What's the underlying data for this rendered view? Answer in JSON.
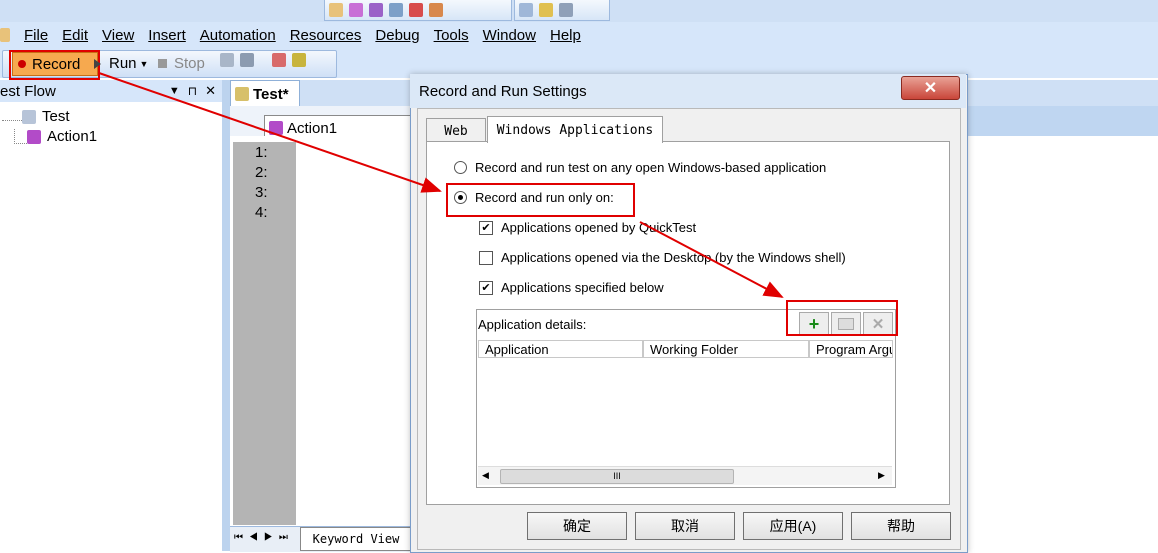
{
  "menu": [
    "File",
    "Edit",
    "View",
    "Insert",
    "Automation",
    "Resources",
    "Debug",
    "Tools",
    "Window",
    "Help"
  ],
  "toolbar": {
    "record_label": "Record",
    "run_label": "Run",
    "stop_label": "Stop"
  },
  "left_panel": {
    "title": "est Flow",
    "tree_root": "Test",
    "tree_child": "Action1"
  },
  "editor": {
    "tab_title": "Test*",
    "action_name": "Action1",
    "line_numbers": [
      "1:",
      "2:",
      "3:",
      "4:"
    ],
    "bottom_tab": "Keyword View"
  },
  "dialog": {
    "title": "Record and Run Settings",
    "close": "✕",
    "tabs": [
      "Web",
      "Windows Applications"
    ],
    "radio_any": "Record and run test on any open Windows-based application",
    "radio_only": "Record and run only on:",
    "check_quicktest": "Applications opened by QuickTest",
    "check_desktop": "Applications opened via the Desktop (by the Windows shell)",
    "check_specified": "Applications specified below",
    "app_details_label": "Application details:",
    "columns": [
      "Application",
      "Working Folder",
      "Program Argu"
    ],
    "scroll_grip": "III",
    "buttons": [
      "确定",
      "取消",
      "应用(A)",
      "帮助"
    ]
  },
  "colors": {
    "highlight": "#e00000",
    "accent": "#d6e6fa",
    "record_bg": "#f6a94f"
  }
}
